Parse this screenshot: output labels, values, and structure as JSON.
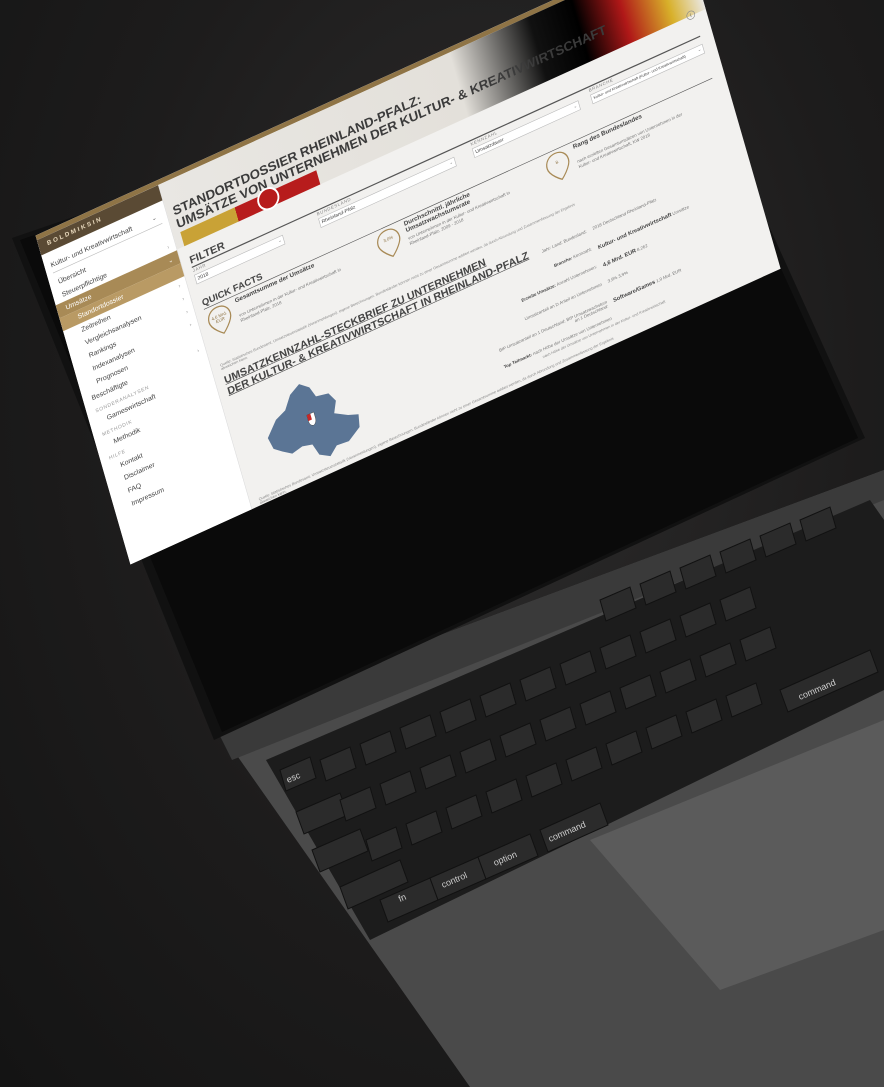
{
  "sidebar": {
    "logo": "BOLDMIKSIN",
    "dropdown": "Kultur- und Kreativwirtschaft",
    "items": [
      {
        "label": "Übersicht"
      },
      {
        "label": "Steuerpflichtige"
      },
      {
        "label": "Umsätze"
      },
      {
        "label": "Standortdossier"
      },
      {
        "label": "Zeitreihen"
      },
      {
        "label": "Vergleichsanalysen"
      },
      {
        "label": "Rankings"
      },
      {
        "label": "Indexanalysen"
      },
      {
        "label": "Prognosen"
      },
      {
        "label": "Beschäftigte"
      }
    ],
    "section_sonder": "SONDERANALYSEN",
    "sonder_item": "Gameswirtschaft",
    "section_methodik": "METHODIK",
    "methodik_item": "Methodik",
    "section_hilfe": "HILFE",
    "hilfe_items": [
      {
        "label": "Kontakt"
      },
      {
        "label": "Disclaimer"
      },
      {
        "label": "FAQ"
      },
      {
        "label": "Impressum"
      }
    ]
  },
  "hero": {
    "title_line1": "STANDORTDOSSIER RHEINLAND-PFALZ:",
    "title_line2": "UMSÄTZE VON UNTERNEHMEN DER KULTUR- & KREATIVWIRTSCHAFT"
  },
  "filter": {
    "title": "FILTER",
    "fields": [
      {
        "label": "JAHR",
        "value": "2018"
      },
      {
        "label": "BUNDESLAND",
        "value": "Rheinland-Pfalz"
      },
      {
        "label": "KENNZAHL",
        "value": "Umsatzdauer"
      },
      {
        "label": "BRANCHE",
        "value": "Kultur- und Kreativwirtschaft (Kultur- und Kreativwirtschaft)"
      }
    ]
  },
  "quick_facts": {
    "title": "QUICK FACTS",
    "cards": [
      {
        "pin": "4,6 Mrd. EUR",
        "head": "Gesamtsumme der Umsätze",
        "desc": "von Unternehmen in der Kultur- und Kreativwirtschaft in Rheinland-Pfalz, 2018"
      },
      {
        "pin": "3,0%",
        "head": "Durchschnittl. jährliche Umsatzwachstumsrate",
        "desc": "von Unternehmen in der Kultur- und Kreativwirtschaft in Rheinland-Pfalz, 2009 - 2018"
      },
      {
        "pin": "8.",
        "head": "Rang des Bundeslandes",
        "desc": "nach erzielten Gesamtumsätzen von Unternehmen in der Kultur- und Kreativwirtschaft, KW 2018"
      }
    ],
    "source": "Quelle: Statistisches Bundesamt, Umsatzsteuerstatistik (Voranmeldungen), eigene Berechnungen. Bundesländer können nicht zu einer Gesamtsumme addiert werden, da durch Abrundung und Zusammenfassung der Ergebnis abweichen kann."
  },
  "steckbrief": {
    "title_line1": "UMSATZKENNZAHL-STECKBRIEF ZU UNTERNEHMEN",
    "title_line2": "DER KULTUR- & KREATIVWIRTSCHAFT IN RHEINLAND-PFALZ",
    "facts": [
      {
        "key_bold": "",
        "key": "Jahr: Land: Bundesland:",
        "value_bold": "",
        "value": "2018 Deutschland Rheinland-Pfalz"
      },
      {
        "key_bold": "Branche:",
        "key": "Kennzahl:",
        "value_bold": "Kultur- und Kreativwirtschaft",
        "value": "Umsätze"
      },
      {
        "key_bold": "Erzielte Umsätze:",
        "key": "Anzahl Unternehmen:",
        "value_bold": "4,6 Mrd. EUR",
        "value": "8.262"
      },
      {
        "key_bold": "Umsatzanteil an D",
        "key": "Anteil an Unternehmen",
        "value_bold": "3,9%",
        "value": "3,9%"
      },
      {
        "key_bold": "BIP Umsatzanteil an 1 Deutschland:",
        "key": "BIP Umsatzwachstum an 1 Deutschland:",
        "value_bold": "Software/Games",
        "value": "1,9 Mrd. EUR"
      },
      {
        "key_bold": "Top Teilmarkt:",
        "key": "nach Höhe der Umsätze von Unternehmen",
        "value_bold": "",
        "value": ""
      }
    ],
    "note": "nach Höhe der Umsätze von Unternehmen in der Kultur- und Kreativwirtschaft",
    "source": "Quelle: Statistisches Bundesamt, Umsatzsteuerstatistik (Voranmeldungen), eigene Berechnungen. Bundesländer können nicht zu einer Gesamtsumme addiert werden, da durch Abrundung und Zusammenfassung der Ergebnis abweichen kann."
  },
  "colors": {
    "accent": "#a88a56",
    "map": "#5b7595",
    "topbar": "#8f7446"
  },
  "keyboard": {
    "keys_row1": [
      "esc",
      "!",
      "@",
      "#",
      "$",
      "%",
      "^",
      "&",
      "*",
      "(",
      ")"
    ],
    "left_keys": [
      "fn",
      "control",
      "option",
      "command"
    ],
    "right_keys": [
      "command"
    ]
  }
}
